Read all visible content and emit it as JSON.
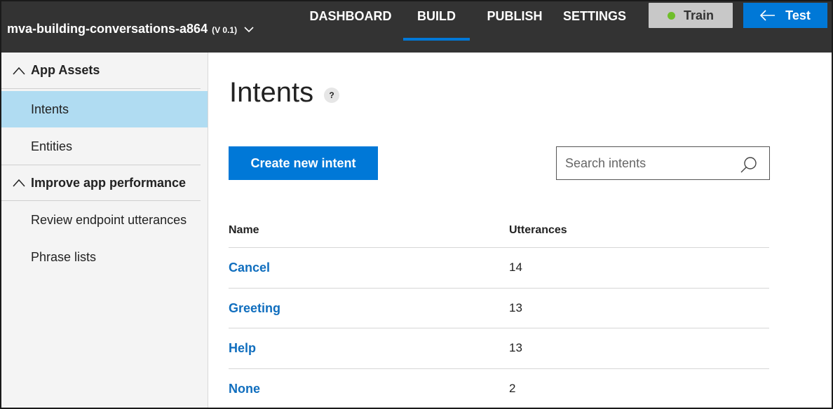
{
  "header": {
    "app_name": "mva-building-conversations-a864",
    "version": "(V 0.1)",
    "tabs": [
      {
        "label": "DASHBOARD"
      },
      {
        "label": "BUILD"
      },
      {
        "label": "PUBLISH"
      },
      {
        "label": "SETTINGS"
      }
    ],
    "active_tab": "BUILD",
    "train_label": "Train",
    "test_label": "Test",
    "accent_color": "#0078d7",
    "train_status_color": "#6fbe2a"
  },
  "sidebar": {
    "sections": [
      {
        "label": "App Assets",
        "items": [
          {
            "label": "Intents"
          },
          {
            "label": "Entities"
          }
        ]
      },
      {
        "label": "Improve app performance",
        "items": [
          {
            "label": "Review endpoint utterances"
          },
          {
            "label": "Phrase lists"
          }
        ]
      }
    ],
    "active_item": "Intents"
  },
  "main": {
    "title": "Intents",
    "help_label": "?",
    "create_button_label": "Create new intent",
    "search_placeholder": "Search intents",
    "columns": [
      "Name",
      "Utterances"
    ],
    "rows": [
      {
        "name": "Cancel",
        "utterances": "14"
      },
      {
        "name": "Greeting",
        "utterances": "13"
      },
      {
        "name": "Help",
        "utterances": "13"
      },
      {
        "name": "None",
        "utterances": "2"
      }
    ]
  }
}
